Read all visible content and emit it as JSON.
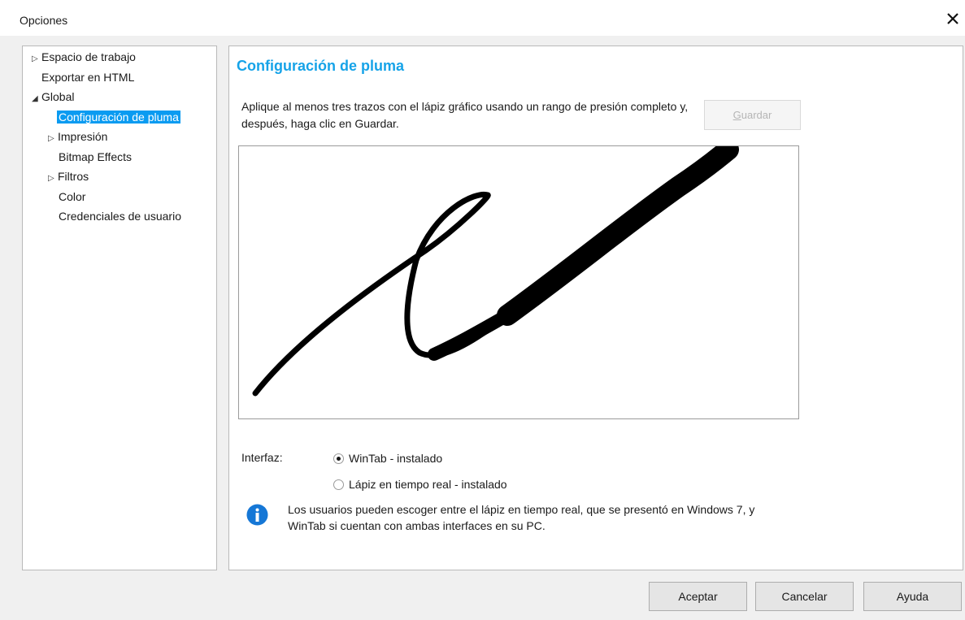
{
  "window": {
    "title": "Opciones"
  },
  "tree": {
    "items": [
      {
        "label": "Espacio de trabajo",
        "expander": "right"
      },
      {
        "label": "Exportar en HTML",
        "expander": "none"
      },
      {
        "label": "Global",
        "expander": "down"
      },
      {
        "label": "Configuración de pluma",
        "expander": "none",
        "selected": true
      },
      {
        "label": "Impresión",
        "expander": "right"
      },
      {
        "label": "Bitmap Effects",
        "expander": "none"
      },
      {
        "label": "Filtros",
        "expander": "right"
      },
      {
        "label": "Color",
        "expander": "none"
      },
      {
        "label": "Credenciales de usuario",
        "expander": "none"
      }
    ]
  },
  "content": {
    "heading": "Configuración de pluma",
    "instructions": "Aplique al menos tres trazos con el lápiz gráfico usando un rango de presión completo y, después, haga clic en Guardar.",
    "save_button": {
      "mnemonic": "G",
      "rest": "uardar",
      "enabled": false
    },
    "interface_label": "Interfaz:",
    "radio_options": [
      {
        "label": "WinTab - instalado",
        "checked": true
      },
      {
        "label": "Lápiz en tiempo real - instalado",
        "checked": false
      }
    ],
    "info_text": "Los usuarios pueden escoger entre el lápiz en tiempo real, que se presentó en Windows 7, y WinTab si cuentan con ambas interfaces en su PC."
  },
  "footer": {
    "ok_label": "Aceptar",
    "cancel_label": "Cancelar",
    "help_label": "Ayuda"
  },
  "colors": {
    "accent_heading": "#16a3e8",
    "selection": "#0a9bf1",
    "info_icon": "#1577d6"
  },
  "icons": {
    "close": "close-icon",
    "info": "info-icon",
    "expand": "triangle-right-icon",
    "collapse": "triangle-down-icon"
  }
}
